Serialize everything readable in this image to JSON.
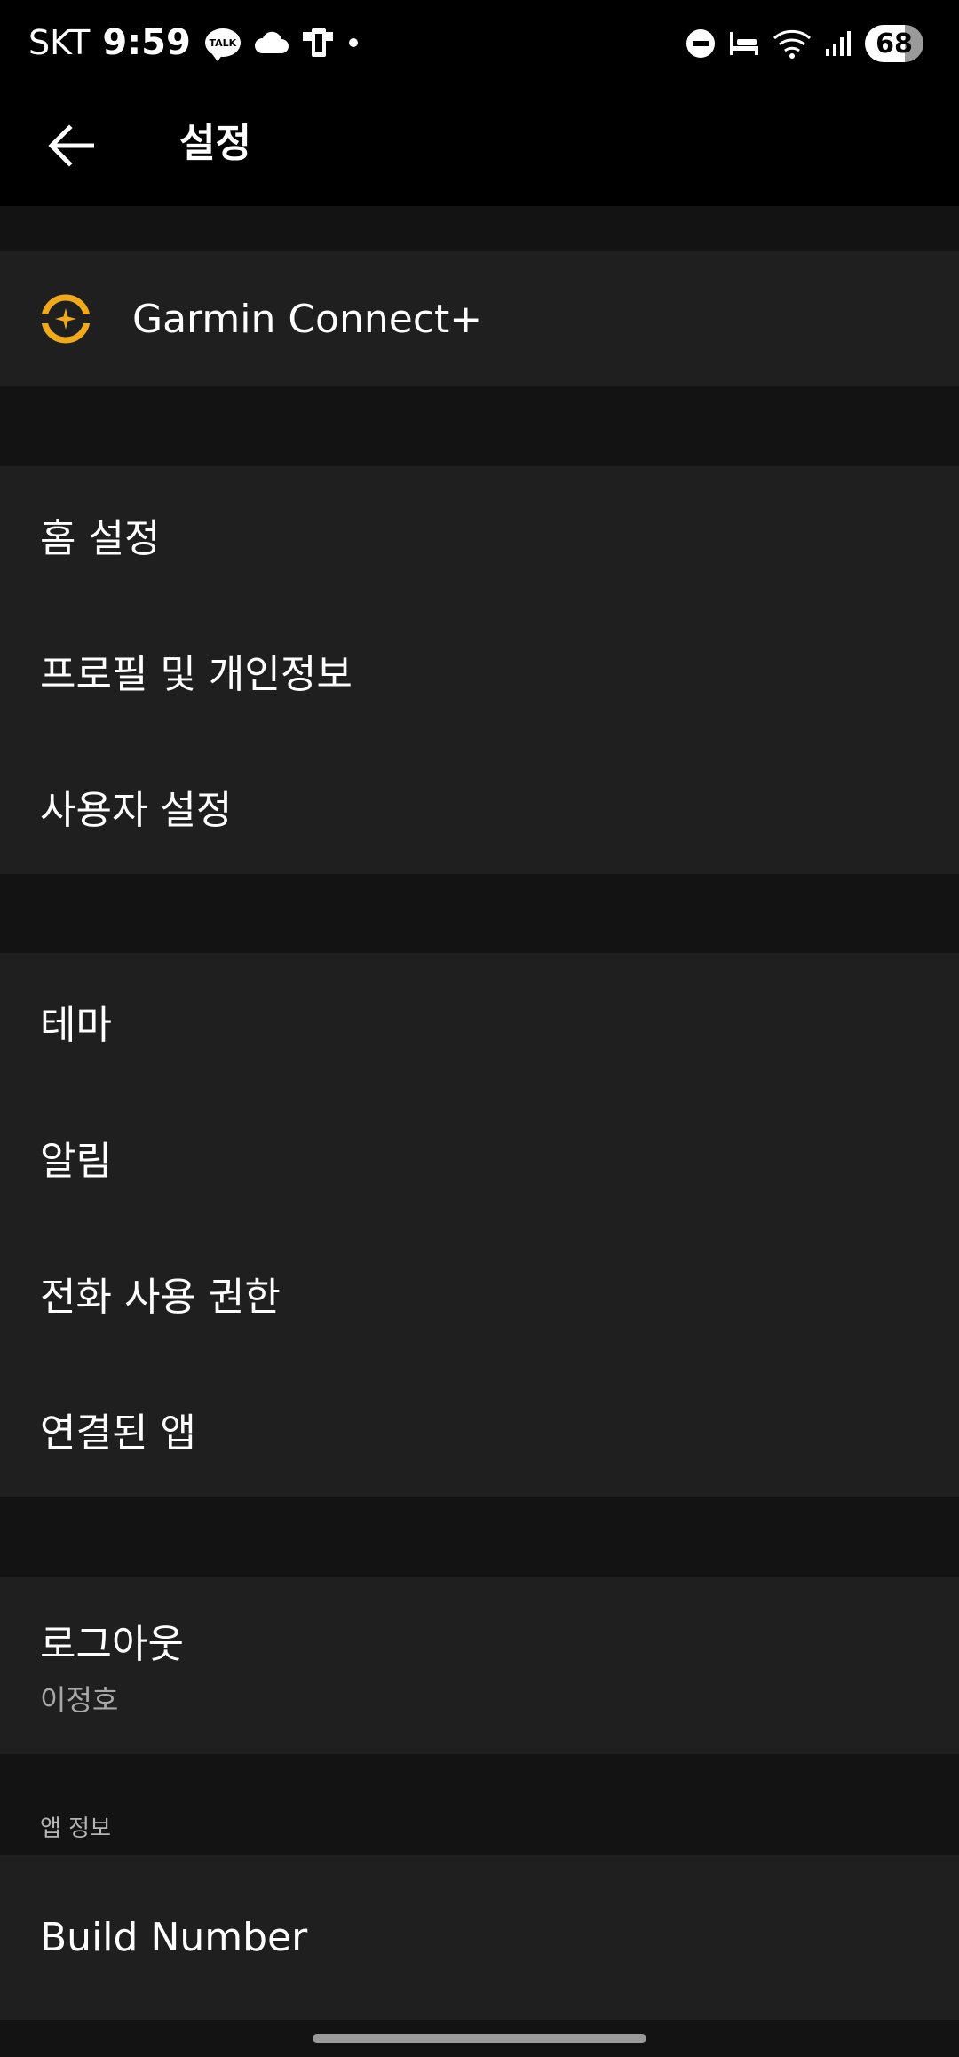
{
  "status_bar": {
    "carrier": "SKT",
    "time": "9:59",
    "talk_label": "TALK",
    "battery": "68"
  },
  "toolbar": {
    "title": "설정"
  },
  "garmin_connect": {
    "label": "Garmin Connect+",
    "accent_color": "#f0a919"
  },
  "section_general": {
    "items": [
      {
        "label": "홈 설정"
      },
      {
        "label": "프로필 및 개인정보"
      },
      {
        "label": "사용자 설정"
      }
    ]
  },
  "section_app": {
    "items": [
      {
        "label": "테마"
      },
      {
        "label": "알림"
      },
      {
        "label": "전화 사용 권한"
      },
      {
        "label": "연결된 앱"
      }
    ]
  },
  "logout": {
    "label": "로그아웃",
    "username": "이정호"
  },
  "app_info": {
    "header": "앱 정보",
    "build_number_label": "Build Number"
  }
}
